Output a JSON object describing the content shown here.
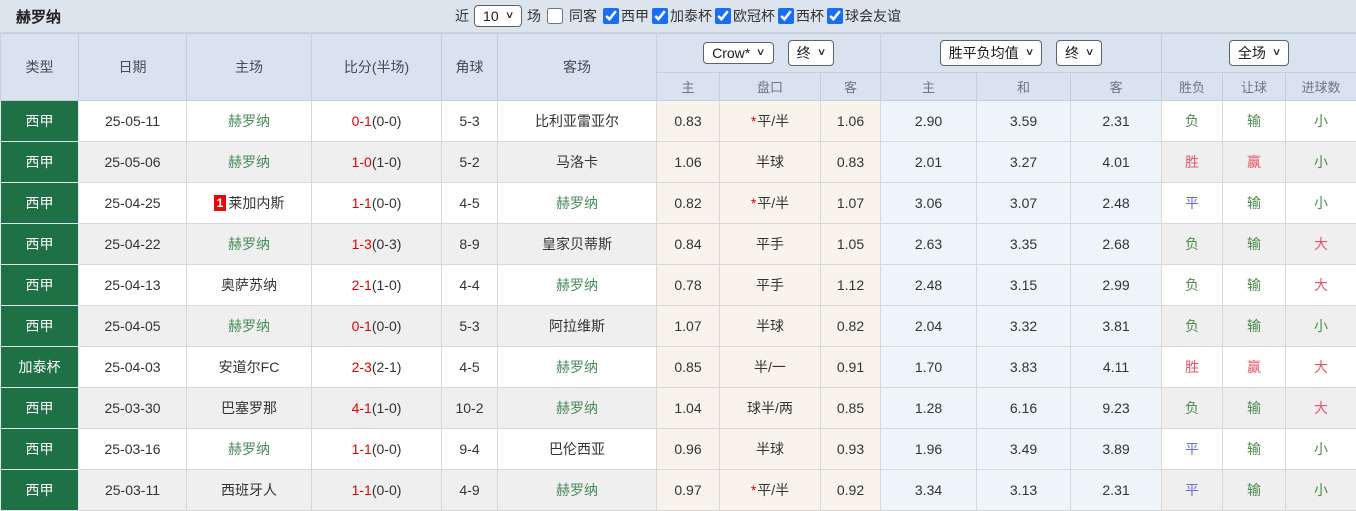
{
  "title": "赫罗纳",
  "toolbar": {
    "recent_label": "近",
    "recent_value": "10",
    "matches_label": "场",
    "same_venue": {
      "label": "同客",
      "checked": false
    },
    "leagues": [
      {
        "label": "西甲",
        "checked": true
      },
      {
        "label": "加泰杯",
        "checked": true
      },
      {
        "label": "欧冠杯",
        "checked": true
      },
      {
        "label": "西杯",
        "checked": true
      },
      {
        "label": "球会友谊",
        "checked": true
      }
    ]
  },
  "table": {
    "left_headers": [
      "类型",
      "日期",
      "主场",
      "比分(半场)",
      "角球",
      "客场"
    ],
    "selects": {
      "odds_company": "Crow*",
      "odds_stage1": "终",
      "avg_type": "胜平负均值",
      "odds_stage2": "终",
      "scope": "全场"
    },
    "sub_headers": [
      "主",
      "盘口",
      "客",
      "主",
      "和",
      "客",
      "胜负",
      "让球",
      "进球数"
    ],
    "rows": [
      {
        "league": "西甲",
        "date": "25-05-11",
        "home": {
          "name": "赫罗纳",
          "girona": true,
          "badge": ""
        },
        "score": "0-1",
        "half": "(0-0)",
        "corner": "5-3",
        "away": {
          "name": "比利亚雷亚尔",
          "girona": false
        },
        "crow": {
          "home": "0.83",
          "star": "*",
          "handicap": "平/半",
          "away": "1.06"
        },
        "avg": {
          "home": "2.90",
          "draw": "3.59",
          "away": "2.31"
        },
        "result": {
          "text": "负",
          "color": "green"
        },
        "handicap_result": {
          "text": "输",
          "color": "green"
        },
        "goals": {
          "text": "小",
          "color": "green"
        }
      },
      {
        "league": "西甲",
        "date": "25-05-06",
        "home": {
          "name": "赫罗纳",
          "girona": true,
          "badge": ""
        },
        "score": "1-0",
        "half": "(1-0)",
        "corner": "5-2",
        "away": {
          "name": "马洛卡",
          "girona": false
        },
        "crow": {
          "home": "1.06",
          "star": "",
          "handicap": "半球",
          "away": "0.83"
        },
        "avg": {
          "home": "2.01",
          "draw": "3.27",
          "away": "4.01"
        },
        "result": {
          "text": "胜",
          "color": "red"
        },
        "handicap_result": {
          "text": "赢",
          "color": "red"
        },
        "goals": {
          "text": "小",
          "color": "green"
        }
      },
      {
        "league": "西甲",
        "date": "25-04-25",
        "home": {
          "name": "莱加内斯",
          "girona": false,
          "badge": "1"
        },
        "score": "1-1",
        "half": "(0-0)",
        "corner": "4-5",
        "away": {
          "name": "赫罗纳",
          "girona": true
        },
        "crow": {
          "home": "0.82",
          "star": "*",
          "handicap": "平/半",
          "away": "1.07"
        },
        "avg": {
          "home": "3.06",
          "draw": "3.07",
          "away": "2.48"
        },
        "result": {
          "text": "平",
          "color": "blue"
        },
        "handicap_result": {
          "text": "输",
          "color": "green"
        },
        "goals": {
          "text": "小",
          "color": "green"
        }
      },
      {
        "league": "西甲",
        "date": "25-04-22",
        "home": {
          "name": "赫罗纳",
          "girona": true,
          "badge": ""
        },
        "score": "1-3",
        "half": "(0-3)",
        "corner": "8-9",
        "away": {
          "name": "皇家贝蒂斯",
          "girona": false
        },
        "crow": {
          "home": "0.84",
          "star": "",
          "handicap": "平手",
          "away": "1.05"
        },
        "avg": {
          "home": "2.63",
          "draw": "3.35",
          "away": "2.68"
        },
        "result": {
          "text": "负",
          "color": "green"
        },
        "handicap_result": {
          "text": "输",
          "color": "green"
        },
        "goals": {
          "text": "大",
          "color": "red"
        }
      },
      {
        "league": "西甲",
        "date": "25-04-13",
        "home": {
          "name": "奥萨苏纳",
          "girona": false,
          "badge": ""
        },
        "score": "2-1",
        "half": "(1-0)",
        "corner": "4-4",
        "away": {
          "name": "赫罗纳",
          "girona": true
        },
        "crow": {
          "home": "0.78",
          "star": "",
          "handicap": "平手",
          "away": "1.12"
        },
        "avg": {
          "home": "2.48",
          "draw": "3.15",
          "away": "2.99"
        },
        "result": {
          "text": "负",
          "color": "green"
        },
        "handicap_result": {
          "text": "输",
          "color": "green"
        },
        "goals": {
          "text": "大",
          "color": "red"
        }
      },
      {
        "league": "西甲",
        "date": "25-04-05",
        "home": {
          "name": "赫罗纳",
          "girona": true,
          "badge": ""
        },
        "score": "0-1",
        "half": "(0-0)",
        "corner": "5-3",
        "away": {
          "name": "阿拉维斯",
          "girona": false
        },
        "crow": {
          "home": "1.07",
          "star": "",
          "handicap": "半球",
          "away": "0.82"
        },
        "avg": {
          "home": "2.04",
          "draw": "3.32",
          "away": "3.81"
        },
        "result": {
          "text": "负",
          "color": "green"
        },
        "handicap_result": {
          "text": "输",
          "color": "green"
        },
        "goals": {
          "text": "小",
          "color": "green"
        }
      },
      {
        "league": "加泰杯",
        "date": "25-04-03",
        "home": {
          "name": "安道尔FC",
          "girona": false,
          "badge": ""
        },
        "score": "2-3",
        "half": "(2-1)",
        "corner": "4-5",
        "away": {
          "name": "赫罗纳",
          "girona": true
        },
        "crow": {
          "home": "0.85",
          "star": "",
          "handicap": "半/一",
          "away": "0.91"
        },
        "avg": {
          "home": "1.70",
          "draw": "3.83",
          "away": "4.11"
        },
        "result": {
          "text": "胜",
          "color": "red"
        },
        "handicap_result": {
          "text": "赢",
          "color": "red"
        },
        "goals": {
          "text": "大",
          "color": "red"
        }
      },
      {
        "league": "西甲",
        "date": "25-03-30",
        "home": {
          "name": "巴塞罗那",
          "girona": false,
          "badge": ""
        },
        "score": "4-1",
        "half": "(1-0)",
        "corner": "10-2",
        "away": {
          "name": "赫罗纳",
          "girona": true
        },
        "crow": {
          "home": "1.04",
          "star": "",
          "handicap": "球半/两",
          "away": "0.85"
        },
        "avg": {
          "home": "1.28",
          "draw": "6.16",
          "away": "9.23"
        },
        "result": {
          "text": "负",
          "color": "green"
        },
        "handicap_result": {
          "text": "输",
          "color": "green"
        },
        "goals": {
          "text": "大",
          "color": "red"
        }
      },
      {
        "league": "西甲",
        "date": "25-03-16",
        "home": {
          "name": "赫罗纳",
          "girona": true,
          "badge": ""
        },
        "score": "1-1",
        "half": "(0-0)",
        "corner": "9-4",
        "away": {
          "name": "巴伦西亚",
          "girona": false
        },
        "crow": {
          "home": "0.96",
          "star": "",
          "handicap": "半球",
          "away": "0.93"
        },
        "avg": {
          "home": "1.96",
          "draw": "3.49",
          "away": "3.89"
        },
        "result": {
          "text": "平",
          "color": "blue"
        },
        "handicap_result": {
          "text": "输",
          "color": "green"
        },
        "goals": {
          "text": "小",
          "color": "green"
        }
      },
      {
        "league": "西甲",
        "date": "25-03-11",
        "home": {
          "name": "西班牙人",
          "girona": false,
          "badge": ""
        },
        "score": "1-1",
        "half": "(0-0)",
        "corner": "4-9",
        "away": {
          "name": "赫罗纳",
          "girona": true
        },
        "crow": {
          "home": "0.97",
          "star": "*",
          "handicap": "平/半",
          "away": "0.92"
        },
        "avg": {
          "home": "3.34",
          "draw": "3.13",
          "away": "2.31"
        },
        "result": {
          "text": "平",
          "color": "blue"
        },
        "handicap_result": {
          "text": "输",
          "color": "green"
        },
        "goals": {
          "text": "小",
          "color": "green"
        }
      }
    ]
  },
  "colors": {
    "league_cell_bg": "#1e7145",
    "girona_team_text": "#468c5a",
    "score_text": "#e80000",
    "win_text": "#e85566",
    "draw_text": "#6a6af2",
    "lose_text": "#4c8b4c",
    "checkbox_accent": "#1a6ef5",
    "header_bg": "#d9e3ef",
    "odds_col_bg": "#f8f4ec",
    "avg_col_bg": "#edf5fa"
  }
}
